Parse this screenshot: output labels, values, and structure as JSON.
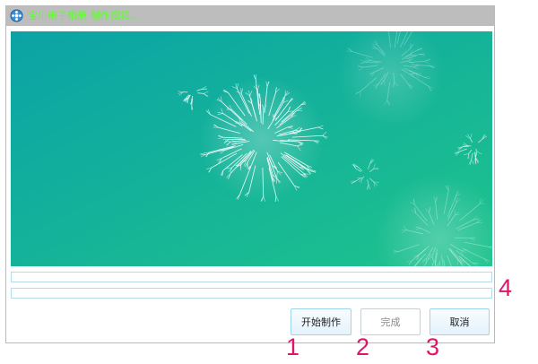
{
  "window": {
    "title": "宝川电子相册 制作视频...",
    "title_color": "#5dff2a"
  },
  "progress": {
    "bar1_percent": 0,
    "bar2_percent": 0
  },
  "buttons": {
    "start_label": "开始制作",
    "done_label": "完成",
    "cancel_label": "取消"
  },
  "annotations": {
    "a1": "1",
    "a2": "2",
    "a3": "3",
    "a4": "4",
    "color": "#e0156a"
  },
  "icons": {
    "app": "film-reel-icon"
  },
  "colors": {
    "preview_gradient": [
      "#0aa7a4",
      "#1cc58e"
    ],
    "accent": "#4fb0e3"
  }
}
